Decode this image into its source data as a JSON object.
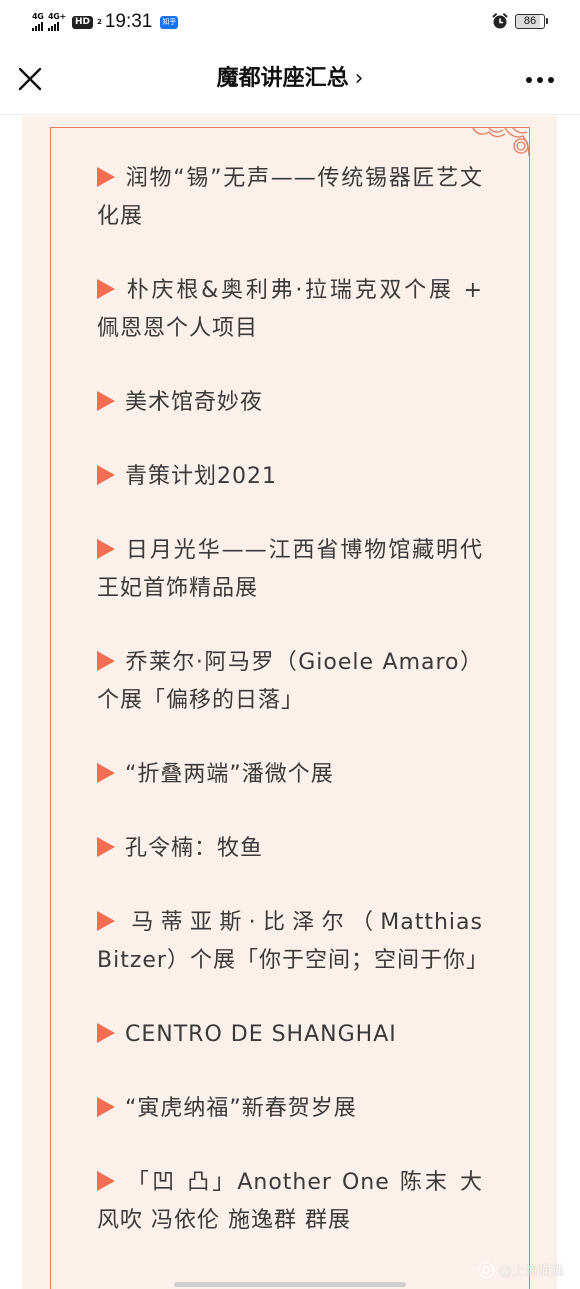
{
  "status_bar": {
    "network_1": "4G",
    "network_2": "4G+",
    "hd_label": "HD",
    "hd_sub": "2",
    "time": "19:31",
    "app_badge": "知乎",
    "battery": "86"
  },
  "header": {
    "title": "魔都讲座汇总",
    "chevron": "›"
  },
  "exhibits": [
    {
      "text": "润物“锡”无声——传统锡器匠艺文化展"
    },
    {
      "text": "朴庆根&奥利弗·拉瑞克双个展 + 佩恩恩个人项目"
    },
    {
      "text": "美术馆奇妙夜"
    },
    {
      "text": "青策计划2021"
    },
    {
      "text": "日月光华——江西省博物馆藏明代王妃首饰精品展"
    },
    {
      "text": "乔莱尔·阿马罗（Gioele Amaro）个展「偏移的日落」"
    },
    {
      "text": "“折叠两端”潘微个展"
    },
    {
      "text": "孔令楠：牧鱼"
    },
    {
      "text": "马蒂亚斯·比泽尔（Matthias Bitzer）个展「你于空间；空间于你」"
    },
    {
      "text": "CENTRO DE SHANGHAI"
    },
    {
      "text": "“寅虎纳福”新春贺岁展"
    },
    {
      "text": "「凹 凸」Another One 陈末 大风吹 冯依伦 施逸群 群展"
    }
  ],
  "watermark": {
    "text": "@上海猫猫"
  },
  "colors": {
    "accent": "#ef6f55",
    "frame": "#e47a62",
    "content_bg": "#fbf0ea"
  },
  "icons": {
    "close": "close-icon",
    "more": "more-dots-icon",
    "alarm": "alarm-icon",
    "bullet": "triangle-bullet-icon"
  }
}
